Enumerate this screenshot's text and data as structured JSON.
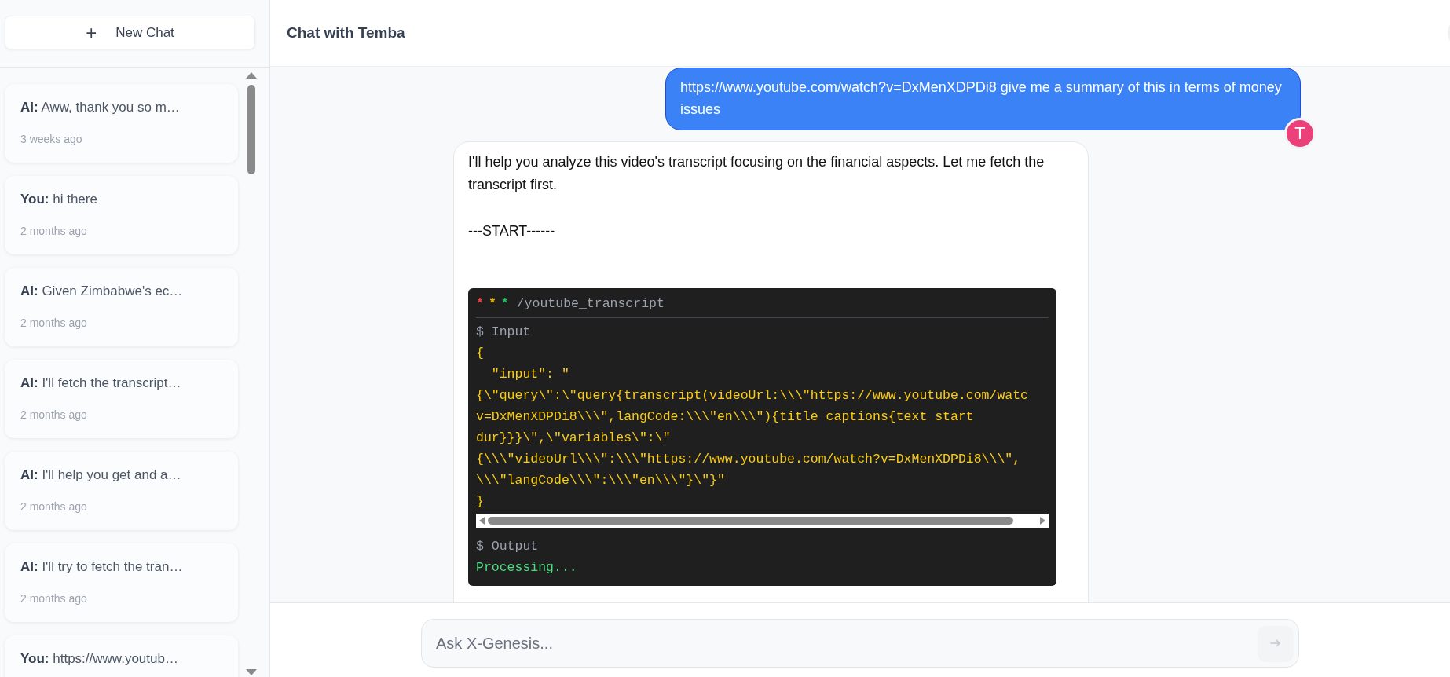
{
  "sidebar": {
    "new_chat_button": {
      "icon": "+",
      "label": "New Chat"
    },
    "conversations": [
      {
        "summary": "**AI:** Aww, thank you so m…",
        "time": "3 weeks ago"
      },
      {
        "summary": "**You:** hi there",
        "time": "2 months ago"
      },
      {
        "summary": "**AI:** Given Zimbabwe's ec…",
        "time": "2 months ago"
      },
      {
        "summary": "**AI:** I'll fetch the transcript…",
        "time": "2 months ago"
      },
      {
        "summary": "**AI:** I'll help you get and a…",
        "time": "2 months ago"
      },
      {
        "summary": "**AI:** I'll try to fetch the tran…",
        "time": "2 months ago"
      },
      {
        "summary": "**You:** https://www.youtub…"
      }
    ]
  },
  "header": {
    "title": "Chat with Temba"
  },
  "messages": [
    {
      "kind": "user",
      "text": "https://www.youtube.com/watch?v=DxMenXDPDi8 give me a summary of this in terms of money issues",
      "avatar": "T"
    },
    {
      "kind": "assistant",
      "paragraphs": [
        "I'll help you analyze this video's transcript focusing on the financial aspects. Let me fetch the transcript first.",
        "---START------"
      ],
      "tool": {
        "dots": [
          {
            "text": "*",
            "color": "#ef4444"
          },
          {
            "text": "*",
            "color": "#eab308"
          },
          {
            "text": "*",
            "color": "#22c55e"
          }
        ],
        "name": "/youtube_transcript",
        "input_label": "$ Input",
        "input_lines": [
          "{",
          "  \"input\": \"",
          "{\\\"query\\\":\\\"query{transcript(videoUrl:\\\\\\\"https://www.youtube.com/watc",
          "v=DxMenXDPDi8\\\\\\\",langCode:\\\\\\\"en\\\\\\\"){title captions{text start",
          "dur}}}\\\",\\\"variables\\\":\\\"",
          "{\\\\\\\"videoUrl\\\\\\\":\\\\\\\"https://www.youtube.com/watch?v=DxMenXDPDi8\\\\\\\",",
          "\\\\\\\"langCode\\\\\\\":\\\\\\\"en\\\\\\\"}\\\"}\"",
          "}"
        ],
        "output_label": "$ Output",
        "output_text": "Processing..."
      }
    }
  ],
  "composer": {
    "placeholder": "Ask X-Genesis..."
  }
}
